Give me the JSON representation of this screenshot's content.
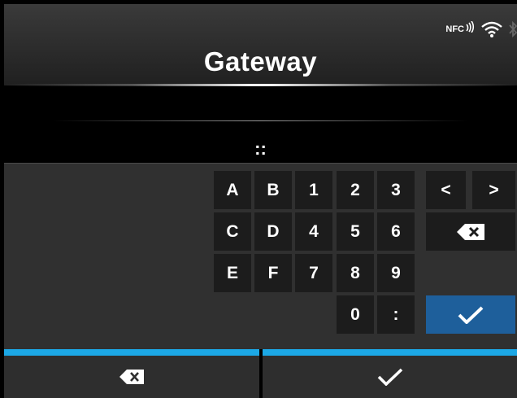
{
  "screen": {
    "title": "Gateway",
    "input_value": "::"
  },
  "status": {
    "nfc_label": "NFC",
    "icons": [
      "nfc-icon",
      "wifi-icon",
      "bluetooth-icon"
    ]
  },
  "keypad": {
    "row1": [
      "A",
      "B",
      "1",
      "2",
      "3",
      "<",
      ">"
    ],
    "row2": [
      "C",
      "D",
      "4",
      "5",
      "6"
    ],
    "row3": [
      "E",
      "F",
      "7",
      "8",
      "9"
    ],
    "row4": [
      "0",
      ":"
    ],
    "backspace_icon": "backspace-icon",
    "confirm_icon": "checkmark-icon"
  },
  "bottom_bar": {
    "left_icon": "backspace-icon",
    "right_icon": "checkmark-icon"
  },
  "colors": {
    "accent": "#1ca8e6",
    "confirm_key": "#1e5f9b",
    "key_bg": "#1c1c1c",
    "panel_bg": "#303030"
  }
}
